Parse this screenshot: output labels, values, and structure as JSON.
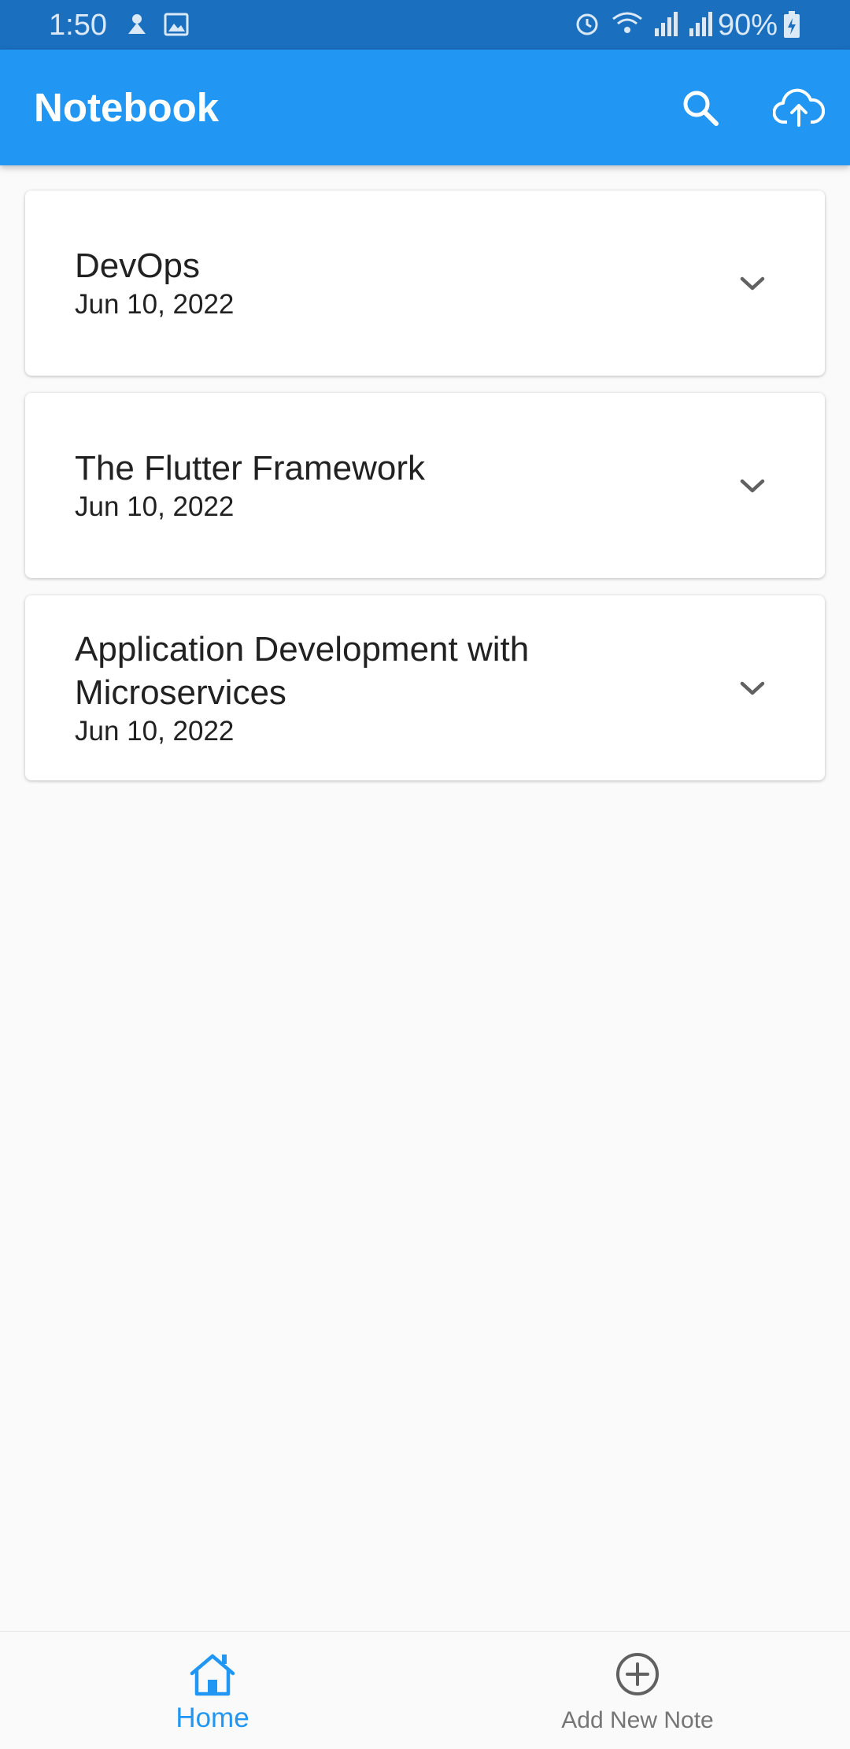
{
  "status_bar": {
    "time": "1:50",
    "battery": "90%",
    "left_icons": [
      "notification-icon",
      "image-icon"
    ],
    "right_icons": [
      "alarm-icon",
      "wifi-icon",
      "signal-icon",
      "signal-icon",
      "battery-charging-icon"
    ]
  },
  "app_bar": {
    "title": "Notebook",
    "actions": [
      "search-icon",
      "cloud-upload-icon"
    ]
  },
  "notes": [
    {
      "title": "DevOps",
      "date": "Jun 10, 2022"
    },
    {
      "title": "The Flutter Framework",
      "date": "Jun 10, 2022"
    },
    {
      "title": "Application Development with Microservices",
      "date": "Jun 10, 2022"
    }
  ],
  "bottom_nav": {
    "home_label": "Home",
    "add_label": "Add New Note",
    "active": "Home"
  },
  "colors": {
    "primary": "#2196f3",
    "status_bar": "#1a6fbf",
    "background": "#fafafa",
    "inactive": "#757575"
  }
}
